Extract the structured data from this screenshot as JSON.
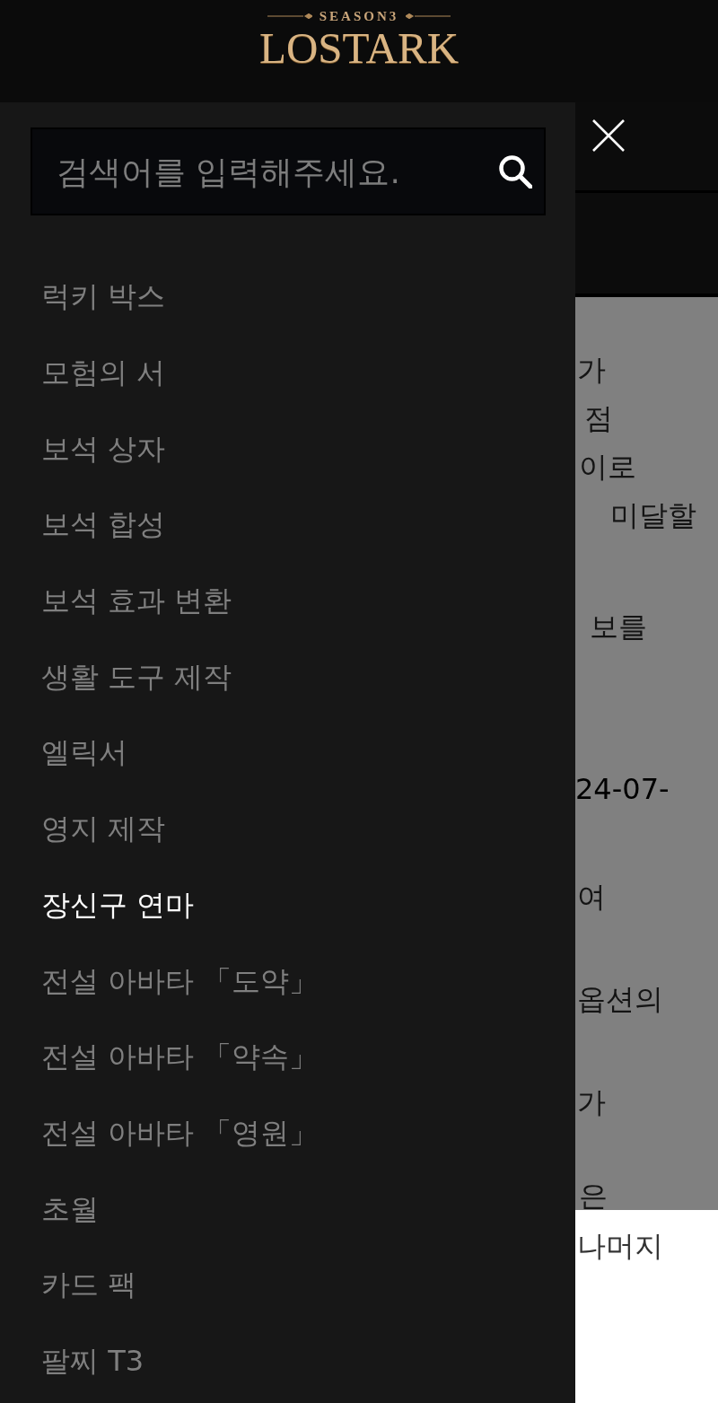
{
  "header": {
    "logo": {
      "season": "SEASON3",
      "title": "LOSTARK"
    }
  },
  "drawer": {
    "search": {
      "placeholder": "검색어를 입력해주세요."
    },
    "menu": [
      {
        "label": "럭키 박스",
        "selected": false
      },
      {
        "label": "모험의 서",
        "selected": false
      },
      {
        "label": "보석 상자",
        "selected": false
      },
      {
        "label": "보석 합성",
        "selected": false
      },
      {
        "label": "보석 효과 변환",
        "selected": false
      },
      {
        "label": "생활 도구 제작",
        "selected": false
      },
      {
        "label": "엘릭서",
        "selected": false
      },
      {
        "label": "영지 제작",
        "selected": false
      },
      {
        "label": "장신구 연마",
        "selected": true
      },
      {
        "label": "전설 아바타 「도약」",
        "selected": false
      },
      {
        "label": "전설 아바타 「약속」",
        "selected": false
      },
      {
        "label": "전설 아바타 「영원」",
        "selected": false
      },
      {
        "label": "초월",
        "selected": false
      },
      {
        "label": "카드 팩",
        "selected": false
      },
      {
        "label": "팔찌 T3",
        "selected": false
      }
    ]
  },
  "background_page": {
    "dimmed_lines": [
      "가",
      "점",
      "이로",
      "미달할",
      "보를",
      "24-07-",
      "여",
      "옵션의",
      "가",
      "은"
    ],
    "lines": [
      "나머지"
    ]
  }
}
